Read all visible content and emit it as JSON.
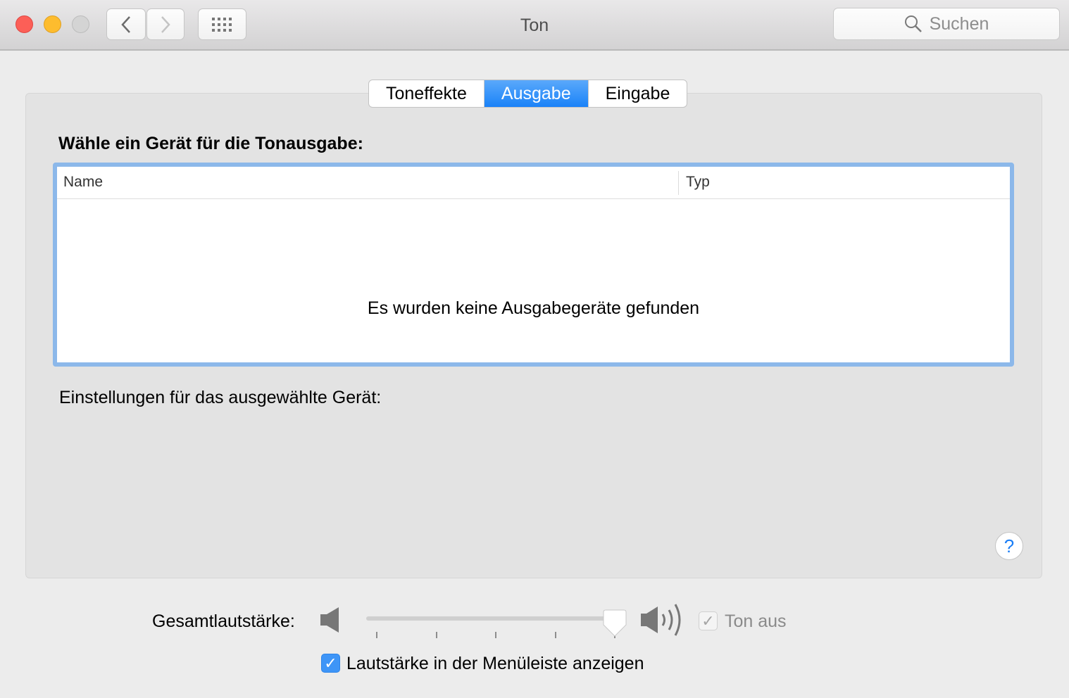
{
  "window": {
    "title": "Ton"
  },
  "search": {
    "placeholder": "Suchen"
  },
  "tabs": [
    {
      "label": "Toneffekte"
    },
    {
      "label": "Ausgabe",
      "selected": true
    },
    {
      "label": "Eingabe"
    }
  ],
  "output": {
    "heading": "Wähle ein Gerät für die Tonausgabe:",
    "columns": [
      "Name",
      "Typ"
    ],
    "empty_message": "Es wurden keine Ausgabegeräte gefunden",
    "settings_label": "Einstellungen für das ausgewählte Gerät:"
  },
  "help": "?",
  "volume": {
    "label": "Gesamtlautstärke:",
    "value_percent": 100,
    "mute_label": "Ton aus",
    "mute_checked": true,
    "mute_enabled": false
  },
  "menubar": {
    "label": "Lautstärke in der Menüleiste anzeigen",
    "checked": true
  },
  "colors": {
    "accent": "#1a82f8"
  }
}
